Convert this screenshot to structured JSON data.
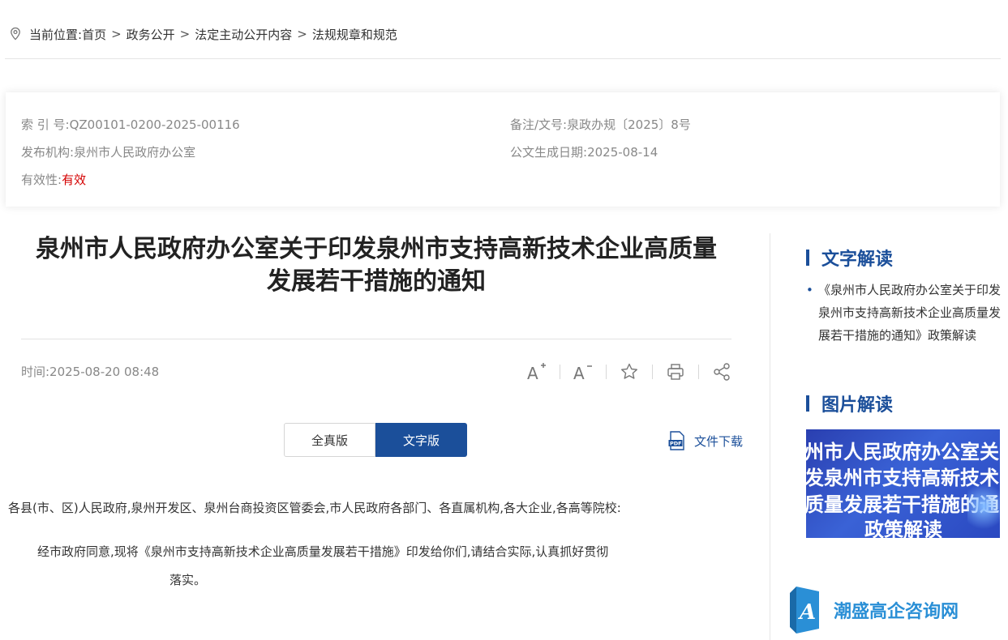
{
  "breadcrumb": {
    "prefix": "当前位置:",
    "items": [
      "首页",
      "政务公开",
      "法定主动公开内容",
      "法规规章和规范"
    ],
    "separator": ">"
  },
  "info": {
    "index_label": "索 引 号:",
    "index_value": "QZ00101-0200-2025-00116",
    "doc_no_label": "备注/文号:",
    "doc_no_value": "泉政办规〔2025〕8号",
    "publisher_label": "发布机构:",
    "publisher_value": "泉州市人民政府办公室",
    "date_label": "公文生成日期:",
    "date_value": "2025-08-14",
    "validity_label": "有效性:",
    "validity_value": "有效"
  },
  "article": {
    "title_line1": "泉州市人民政府办公室关于印发泉州市支持高新技术企业高质量",
    "title_line2": "发展若干措施的通知",
    "time": "时间:2025-08-20 08:48",
    "tabs": [
      "全真版",
      "文字版"
    ],
    "download": "文件下载",
    "salutation": "各县(市、区)人民政府,泉州开发区、泉州台商投资区管委会,市人民政府各部门、各直属机构,各大企业,各高等院校:",
    "para_line1": "经市政府同意,现将《泉州市支持高新技术企业高质量发展若干措施》印发给你们,请结合实际,认真抓好贯彻",
    "para_line2": "落实。"
  },
  "tools": [
    {
      "name": "font-increase-icon",
      "label": "A+"
    },
    {
      "name": "font-decrease-icon",
      "label": "A-"
    },
    {
      "name": "favorite-star-icon"
    },
    {
      "name": "print-icon"
    },
    {
      "name": "share-icon"
    }
  ],
  "sidebar": {
    "text_heading": "文字解读",
    "text_item": "《泉州市人民政府办公室关于印发泉州市支持高新技术企业高质量发展若干措施的通知》政策解读",
    "image_heading": "图片解读",
    "banner_lines": [
      "州市人民政府办公室关",
      "发泉州市支持高新技术",
      "质量发展若干措施的通",
      "政策解读"
    ]
  },
  "watermark": {
    "text": "潮盛高企咨询网"
  },
  "colors": {
    "accent": "#1b4f9a",
    "valid_red": "#d40000",
    "meta_gray": "#888888"
  }
}
